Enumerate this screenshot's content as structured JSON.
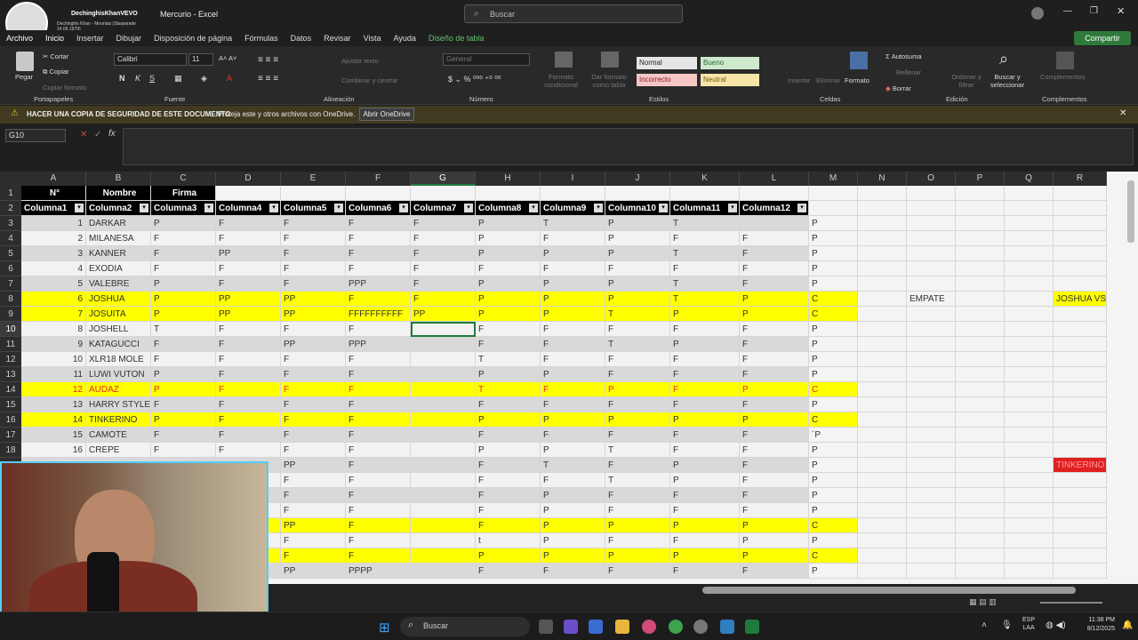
{
  "titlebar": {
    "channel": "DechinghisKhanVEVO",
    "now_playing": "Dechinghis Khan - Moonlas (Starparade 14.06.1979)",
    "doc_title": "Mercurio",
    "app_sep": "-",
    "app_name": "Excel",
    "search_placeholder": "Buscar",
    "share_label": "Compartir"
  },
  "tabs": [
    "Archivo",
    "Inicio",
    "Insertar",
    "Dibujar",
    "Disposición de página",
    "Fórmulas",
    "Datos",
    "Revisar",
    "Vista",
    "Ayuda",
    "Diseño de tabla"
  ],
  "ribbon": {
    "clipboard": {
      "paste": "Pegar",
      "cut": "Cortar",
      "copy": "Copiar",
      "format_painter": "Copiar formato",
      "group": "Portapapeles"
    },
    "font": {
      "name": "Calibri",
      "size": "11",
      "group": "Fuente"
    },
    "alignment": {
      "wrap": "Ajustar texto",
      "merge": "Combinar y centrar",
      "group": "Alineación"
    },
    "number": {
      "format": "General",
      "group": "Número"
    },
    "styles": {
      "cond": "Formato condicional",
      "as_table": "Dar formato como tabla",
      "normal": "Normal",
      "good": "Bueno",
      "bad": "Incorrecto",
      "neutral": "Neutral",
      "group": "Estilos"
    },
    "cells": {
      "insert": "Insertar",
      "delete": "Eliminar",
      "format": "Formato",
      "group": "Celdas"
    },
    "editing": {
      "autosum": "Autosuma",
      "fill": "Rellenar",
      "clear": "Borrar",
      "sort": "Ordenar y filtrar",
      "find": "Buscar y seleccionar",
      "group": "Edición"
    },
    "addins": {
      "label": "Complementos",
      "group": "Complementos"
    }
  },
  "notice": {
    "title": "HACER UNA COPIA DE SEGURIDAD DE ESTE DOCUMENTO",
    "body": "Proteja este y otros archivos con OneDrive.",
    "button": "Abrir OneDrive"
  },
  "formula": {
    "namebox": "G10",
    "fx": "fx",
    "value": ""
  },
  "columns": [
    "A",
    "B",
    "C",
    "D",
    "E",
    "F",
    "G",
    "H",
    "I",
    "J",
    "K",
    "L",
    "M",
    "N",
    "O",
    "P",
    "Q",
    "R"
  ],
  "row1": {
    "a": "N°",
    "b": "Nombre",
    "c": "Firma"
  },
  "table_headers": [
    "Columna1",
    "Columna2",
    "Columna3",
    "Columna4",
    "Columna5",
    "Columna6",
    "Columna7",
    "Columna8",
    "Columna9",
    "Columna10",
    "Columna11",
    "Columna12"
  ],
  "rows": [
    {
      "r": "3",
      "n": "1",
      "name": "DARKAR",
      "c": [
        "P",
        "F",
        "F",
        "F",
        "F",
        "P",
        "T",
        "P",
        "T",
        ""
      ],
      "m": "P",
      "style": "gray"
    },
    {
      "r": "4",
      "n": "2",
      "name": "MILANESA",
      "c": [
        "F",
        "F",
        "F",
        "F",
        "F",
        "P",
        "F",
        "P",
        "F",
        "F"
      ],
      "m": "P",
      "style": "white"
    },
    {
      "r": "5",
      "n": "3",
      "name": "KANNER",
      "c": [
        "F",
        "PP",
        "F",
        "F",
        "F",
        "P",
        "P",
        "P",
        "T",
        "F"
      ],
      "m": "P",
      "style": "gray"
    },
    {
      "r": "6",
      "n": "4",
      "name": "EXODIA",
      "c": [
        "F",
        "F",
        "F",
        "F",
        "F",
        "F",
        "F",
        "F",
        "F",
        "F"
      ],
      "m": "P",
      "style": "white"
    },
    {
      "r": "7",
      "n": "5",
      "name": "VALEBRE",
      "c": [
        "P",
        "F",
        "F",
        "PPP",
        "F",
        "P",
        "P",
        "P",
        "T",
        "F"
      ],
      "m": "P",
      "style": "gray"
    },
    {
      "r": "8",
      "n": "6",
      "name": "JOSHUA",
      "c": [
        "P",
        "PP",
        "PP",
        "F",
        "F",
        "P",
        "P",
        "P",
        "T",
        "P"
      ],
      "m": "C",
      "style": "yellow"
    },
    {
      "r": "9",
      "n": "7",
      "name": "JOSUITA",
      "c": [
        "P",
        "PP",
        "PP",
        "FFFFFFFFFF",
        "PP",
        "P",
        "P",
        "T",
        "P",
        "P"
      ],
      "m": "C",
      "style": "yellow"
    },
    {
      "r": "10",
      "n": "8",
      "name": "JOSHELL",
      "c": [
        "T",
        "F",
        "F",
        "F",
        "",
        "F",
        "F",
        "F",
        "F",
        "F"
      ],
      "m": "P",
      "style": "white"
    },
    {
      "r": "11",
      "n": "9",
      "name": "KATAGUCCI",
      "c": [
        "F",
        "F",
        "PP",
        "PPP",
        "",
        "F",
        "F",
        "T",
        "P",
        "F"
      ],
      "m": "P",
      "style": "gray"
    },
    {
      "r": "12",
      "n": "10",
      "name": "XLR18 MOLE",
      "c": [
        "F",
        "F",
        "F",
        "F",
        "",
        "T",
        "F",
        "F",
        "F",
        "F"
      ],
      "m": "P",
      "style": "white"
    },
    {
      "r": "13",
      "n": "11",
      "name": "LUWI VUTON",
      "c": [
        "P",
        "F",
        "F",
        "F",
        "",
        "P",
        "P",
        "F",
        "F",
        "F"
      ],
      "m": "P",
      "style": "gray"
    },
    {
      "r": "14",
      "n": "12",
      "name": "AUDAZ",
      "c": [
        "P",
        "F",
        "F",
        "F",
        "",
        "T",
        "F",
        "P",
        "F",
        "P"
      ],
      "m": "C",
      "style": "yellowred"
    },
    {
      "r": "15",
      "n": "13",
      "name": "HARRY STYLE",
      "c": [
        "F",
        "F",
        "F",
        "F",
        "",
        "F",
        "F",
        "F",
        "F",
        "F"
      ],
      "m": "P",
      "style": "gray"
    },
    {
      "r": "16",
      "n": "14",
      "name": "TINKERINO",
      "c": [
        "P",
        "F",
        "F",
        "F",
        "",
        "P",
        "P",
        "P",
        "P",
        "P"
      ],
      "m": "C",
      "style": "yellow"
    },
    {
      "r": "17",
      "n": "15",
      "name": "CAMOTE",
      "c": [
        "F",
        "F",
        "F",
        "F",
        "",
        "F",
        "F",
        "F",
        "F",
        "F"
      ],
      "m": "´P",
      "style": "gray"
    },
    {
      "r": "18",
      "n": "16",
      "name": "CREPE",
      "c": [
        "F",
        "F",
        "F",
        "F",
        "",
        "P",
        "P",
        "T",
        "F",
        "F"
      ],
      "m": "P",
      "style": "white"
    },
    {
      "r": "19",
      "n": "",
      "name": "",
      "c": [
        "",
        "",
        "PP",
        "F",
        "",
        "F",
        "T",
        "F",
        "P",
        "F"
      ],
      "m": "P",
      "style": "gray"
    },
    {
      "r": "20",
      "n": "",
      "name": "",
      "c": [
        "",
        "",
        "F",
        "F",
        "",
        "F",
        "F",
        "T",
        "P",
        "F"
      ],
      "m": "P",
      "style": "white"
    },
    {
      "r": "21",
      "n": "",
      "name": "",
      "c": [
        "",
        "",
        "F",
        "F",
        "",
        "F",
        "P",
        "F",
        "F",
        "F"
      ],
      "m": "P",
      "style": "gray"
    },
    {
      "r": "22",
      "n": "",
      "name": "",
      "c": [
        "",
        "",
        "F",
        "F",
        "",
        "F",
        "P",
        "F",
        "F",
        "F"
      ],
      "m": "P",
      "style": "white"
    },
    {
      "r": "23",
      "n": "",
      "name": "",
      "c": [
        "",
        "",
        "PP",
        "F",
        "",
        "F",
        "P",
        "P",
        "P",
        "P"
      ],
      "m": "C",
      "style": "yellow"
    },
    {
      "r": "24",
      "n": "",
      "name": "",
      "c": [
        "",
        "",
        "F",
        "F",
        "",
        "t",
        "P",
        "F",
        "F",
        "P"
      ],
      "m": "P",
      "style": "white"
    },
    {
      "r": "25",
      "n": "",
      "name": "",
      "c": [
        "",
        "",
        "F",
        "F",
        "",
        "P",
        "P",
        "P",
        "P",
        "P"
      ],
      "m": "C",
      "style": "yellow"
    },
    {
      "r": "26",
      "n": "",
      "name": "",
      "c": [
        "",
        "",
        "PP",
        "PPPP",
        "",
        "F",
        "F",
        "F",
        "F",
        "F"
      ],
      "m": "P",
      "style": "gray"
    }
  ],
  "side": {
    "empate": "EMPATE",
    "joshua_vs": "JOSHUA VS JO",
    "tinkerino_vs": "TINKERINO VS"
  },
  "taskbar": {
    "search": "Buscar",
    "lang": "ESP",
    "lang2": "LAA",
    "time": "11:38 PM",
    "date": "8/12/2025"
  }
}
